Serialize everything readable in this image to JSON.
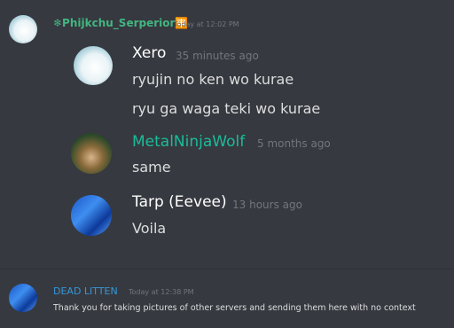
{
  "top_message": {
    "username": "❄Phijkchu_Serperior🈸",
    "username_color": "#43b581",
    "timestamp": "Today at 12:02 PM"
  },
  "embedded_messages": [
    {
      "username": "Xero",
      "username_color": "#ffffff",
      "timestamp": "35 minutes ago",
      "avatar": "white-dragon-avatar",
      "lines": [
        "ryujin no ken wo kurae",
        "ryu ga waga teki wo kurae"
      ]
    },
    {
      "username": "MetalNinjaWolf",
      "username_color": "#1abc9c",
      "timestamp": "5 months ago",
      "avatar": "anime-girl-avatar",
      "lines": [
        "same"
      ]
    },
    {
      "username": "Tarp (Eevee)",
      "username_color": "#ffffff",
      "timestamp": "13 hours ago",
      "avatar": "blue-tarp-avatar",
      "lines": [
        "Voila"
      ]
    }
  ],
  "bottom_message": {
    "username": "DEAD LITTEN",
    "username_color": "#3498db",
    "timestamp": "Today at 12:38 PM",
    "avatar": "blue-tarp-avatar",
    "text": "Thank you for taking pictures of other servers and sending them here with no context"
  }
}
